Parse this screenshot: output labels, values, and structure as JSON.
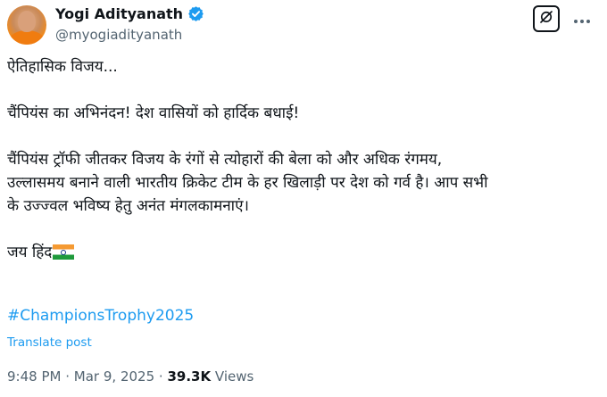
{
  "author": {
    "display_name": "Yogi Adityanath",
    "handle": "@myogiadityanath"
  },
  "icons": {
    "verified": "verified-badge-icon",
    "grok": "grok-icon",
    "more": "more-icon"
  },
  "tweet": {
    "line1": "ऐतिहासिक विजय...",
    "line2": "चैंपियंस का अभिनंदन! देश वासियों को हार्दिक बधाई!",
    "line3": "चैंपियंस ट्रॉफी जीतकर विजय के रंगों से त्योहारों की बेला को और अधिक रंगमय,",
    "line4": "उल्लासमय बनाने वाली भारतीय क्रिकेट टीम के हर खिलाड़ी पर देश को गर्व है। आप सभी",
    "line5": "के उज्ज्वल भविष्य हेतु अनंत मंगलकामनाएं।",
    "line6": "जय हिंद",
    "hashtag": "#ChampionsTrophy2025"
  },
  "translate_label": "Translate post",
  "meta": {
    "time": "9:48 PM",
    "separator": "·",
    "date": "Mar 9, 2025",
    "views_count": "39.3K",
    "views_label": "Views"
  },
  "colors": {
    "link": "#1d9bf0",
    "secondary_text": "#536471",
    "primary_text": "#0f1419"
  }
}
